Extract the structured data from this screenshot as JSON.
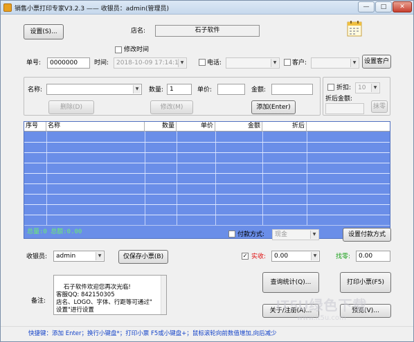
{
  "window": {
    "title": "销售小票打印专家V3.2.3  —— 收银员：admin(管理员)",
    "min_label": "—",
    "max_label": "□",
    "close_label": "✕"
  },
  "header": {
    "settings_button": "设置(S)...",
    "store_label": "店名:",
    "store_name": "石子软件"
  },
  "order": {
    "modify_time_label": "修改时间",
    "number_label": "单号:",
    "number_value": "0000000",
    "time_label": "时间:",
    "time_value": "2018-10-09 17:14:14",
    "phone_label": "电话:",
    "customer_label": "客户:",
    "set_customer_button": "设置客户"
  },
  "item": {
    "name_label": "名称:",
    "name_value": "",
    "qty_label": "数量:",
    "qty_value": "1",
    "price_label": "单价:",
    "price_value": "",
    "amount_label": "金额:",
    "amount_value": "",
    "delete_button": "删除(D)",
    "modify_button": "修改(M)",
    "add_button": "添加(Enter)"
  },
  "discount": {
    "discount_label": "折扣:",
    "discount_value": "10",
    "after_label": "折后金额:",
    "round_button": "抹零"
  },
  "table": {
    "columns": [
      "序号",
      "名称",
      "数量",
      "单价",
      "金额",
      "折后"
    ],
    "totals_text": "总量:0  总额:0.00"
  },
  "payment": {
    "method_label": "付款方式:",
    "method_value": "现金",
    "set_method_button": "设置付款方式",
    "received_label": "实收:",
    "received_value": "0.00",
    "change_label": "找零:",
    "change_value": "0.00"
  },
  "cashier": {
    "label": "收银员:",
    "value": "admin",
    "save_only_button": "仅保存小票(B)"
  },
  "notes": {
    "label": "备注:",
    "text": "石子软件欢迎您再次光临!\n客服QQ: 842150305\n店名、LOGO、字体、行距等可通过\"\n设置\"进行设置"
  },
  "actions": {
    "query_button": "查询统计(Q)...",
    "print_button": "打印小票(F5)",
    "about_button": "关于/注册(A)...",
    "preview_button": "预览(V)..."
  },
  "status_bar": {
    "text": "快捷键：添加 Enter；换行小键盘*；打印小票 F5或小键盘+；鼠标滚轮向前数值增加,向后减少"
  },
  "watermark": {
    "text": "IT5U绿色下载",
    "url": "www.it5u.com"
  },
  "colors": {
    "grid_fill": "#6a8ee8",
    "totals_text": "#6cf06c",
    "received_label": "#e01010",
    "change_label": "#18a018",
    "status_text": "#1040c8"
  }
}
